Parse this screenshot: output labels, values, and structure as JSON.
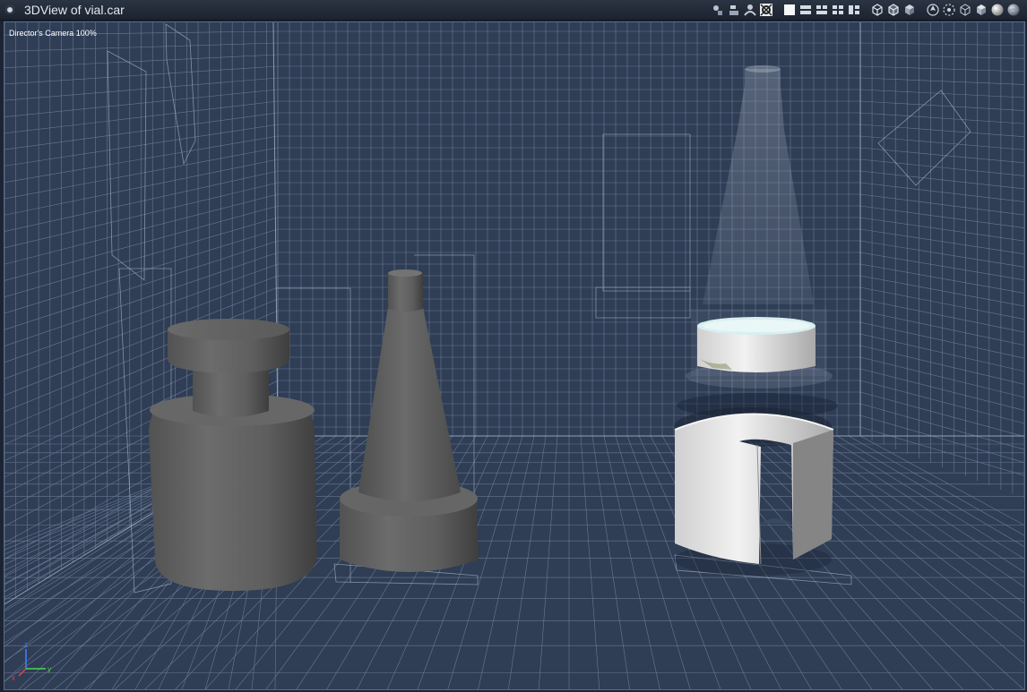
{
  "window": {
    "title": "3DView of vial.car"
  },
  "viewport": {
    "camera_label": "Director's Camera 100%"
  },
  "toolbar": {
    "groups": [
      [
        "light-tool-icon",
        "camera-tool-icon",
        "figure-tool-icon",
        "target-tool-icon"
      ],
      [
        "layout-single-icon",
        "layout-2h-icon",
        "layout-3-icon",
        "layout-4-icon",
        "layout-custom-icon"
      ],
      [
        "box-wire-icon",
        "box-hidden-icon",
        "box-shaded-icon"
      ],
      [
        "navigate-icon",
        "orbit-icon",
        "cube-wire-icon",
        "cube-solid-icon",
        "sphere-smooth-icon",
        "sphere-textured-icon"
      ]
    ]
  },
  "colors": {
    "titlebar": "#1c2330",
    "viewport_bg": "#2f3d55",
    "grid_line": "#7d8ea6",
    "object_grey": "#646464",
    "object_white": "#e6e6e6"
  },
  "axis": {
    "z": "z",
    "x": "x",
    "y": "y"
  }
}
